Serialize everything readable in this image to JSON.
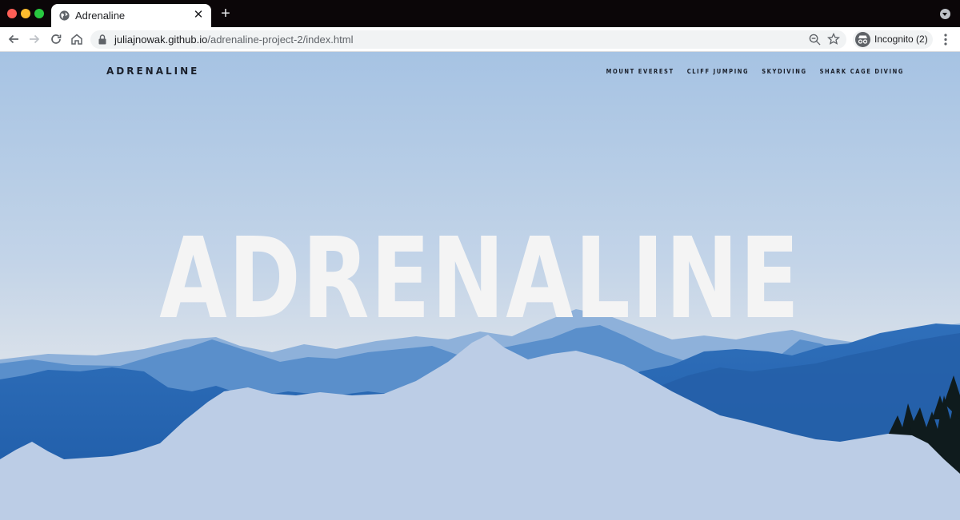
{
  "browser": {
    "tab": {
      "title": "Adrenaline",
      "close_glyph": "✕"
    },
    "new_tab_glyph": "+",
    "address": {
      "host": "juliajnowak.github.io",
      "path": "/adrenaline-project-2/index.html"
    },
    "incognito_label": "Incognito (2)",
    "icons": [
      "globe-icon",
      "back-icon",
      "forward-icon",
      "reload-icon",
      "home-icon",
      "lock-icon",
      "zoom-icon",
      "star-icon",
      "incognito-icon",
      "menu-icon",
      "profile-dropdown-icon"
    ]
  },
  "site": {
    "logo": "ADRENALINE",
    "nav": [
      {
        "label": "MOUNT EVEREST"
      },
      {
        "label": "CLIFF JUMPING"
      },
      {
        "label": "SKYDIVING"
      },
      {
        "label": "SHARK CAGE DIVING"
      }
    ],
    "hero_title": "ADRENALINE"
  },
  "colors": {
    "sky": "#b9cfe6",
    "far_mountains": "#7ea4d2",
    "mid_mountains": "#4f86c4",
    "near_mountains": "#2a68b4",
    "foreground_shape": "#bccde6",
    "trees": "#111c1c",
    "hero_text": "#f4f4f4",
    "nav_text": "#1a1f2a"
  }
}
